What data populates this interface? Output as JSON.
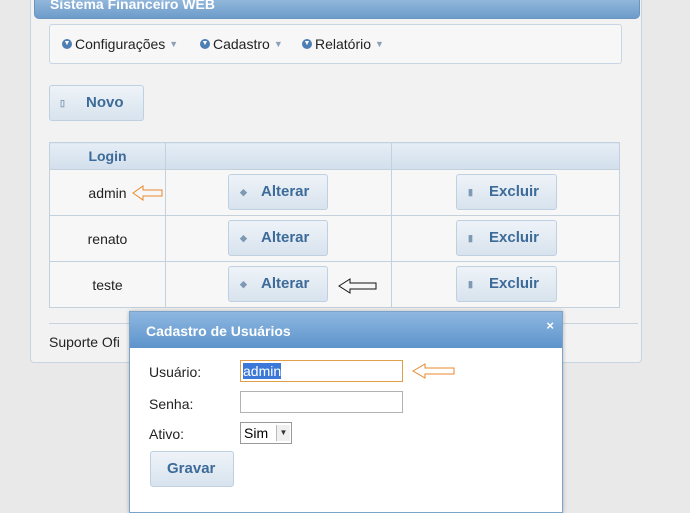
{
  "app": {
    "title": "Sistema Financeiro WEB"
  },
  "menu": {
    "items": [
      {
        "label": "Configurações"
      },
      {
        "label": "Cadastro"
      },
      {
        "label": "Relatório"
      }
    ]
  },
  "toolbar": {
    "new_label": "Novo"
  },
  "table": {
    "headers": [
      "Login",
      "",
      ""
    ],
    "rows": [
      {
        "login": "admin",
        "edit_label": "Alterar",
        "delete_label": "Excluir"
      },
      {
        "login": "renato",
        "edit_label": "Alterar",
        "delete_label": "Excluir"
      },
      {
        "login": "teste",
        "edit_label": "Alterar",
        "delete_label": "Excluir"
      }
    ]
  },
  "footer": {
    "text": "Suporte Ofi"
  },
  "dialog": {
    "title": "Cadastro de Usuários",
    "close_symbol": "×",
    "user_label": "Usuário:",
    "user_value": "admin",
    "password_label": "Senha:",
    "password_value": "",
    "active_label": "Ativo:",
    "active_value": "Sim",
    "save_label": "Gravar"
  },
  "colors": {
    "accent": "#3d6b99",
    "annotation": "#e8892c"
  }
}
